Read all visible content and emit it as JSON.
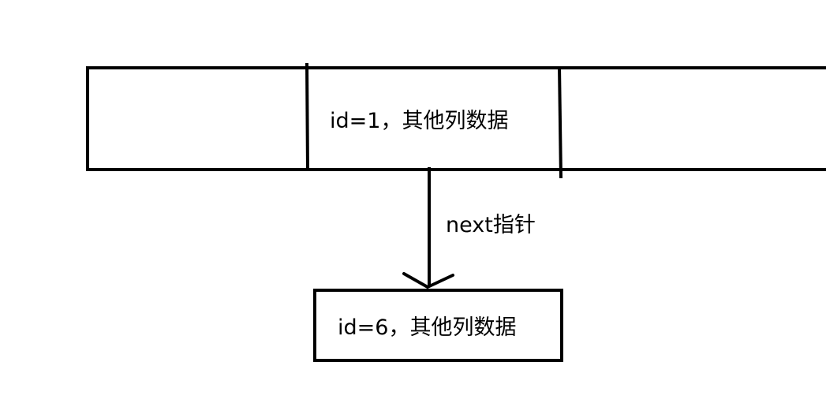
{
  "diagram": {
    "row_cell_text": "id=1，其他列数据",
    "pointer_label": "next指针",
    "next_node_text": "id=6，其他列数据",
    "stroke_color": "#000000",
    "background_color": "#ffffff"
  }
}
